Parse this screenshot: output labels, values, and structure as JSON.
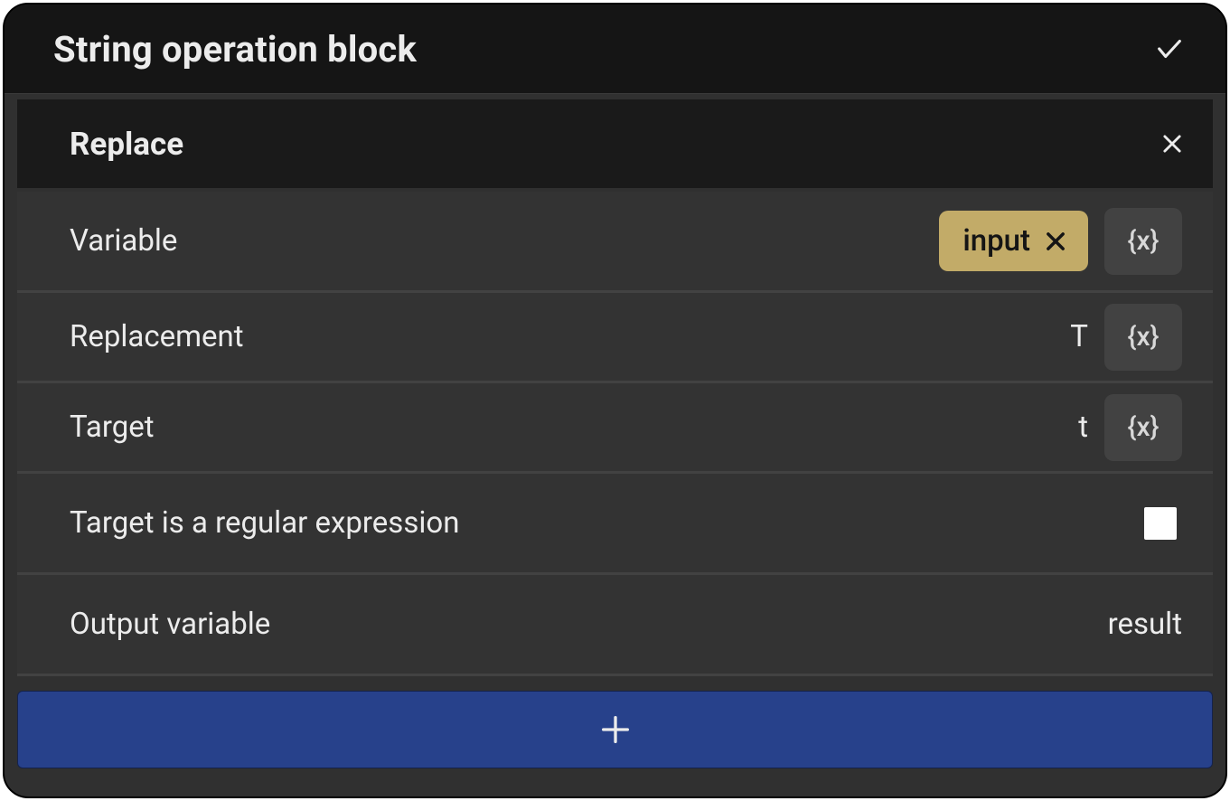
{
  "dialog": {
    "title": "String operation block"
  },
  "operation": {
    "title": "Replace",
    "rows": {
      "variable": {
        "label": "Variable",
        "chip_value": "input"
      },
      "replacement": {
        "label": "Replacement",
        "value": "T"
      },
      "target": {
        "label": "Target",
        "value": "t"
      },
      "regex": {
        "label": "Target is a regular expression",
        "checked": false
      },
      "output": {
        "label": "Output variable",
        "value": "result"
      }
    },
    "var_button_label": "{x}"
  }
}
